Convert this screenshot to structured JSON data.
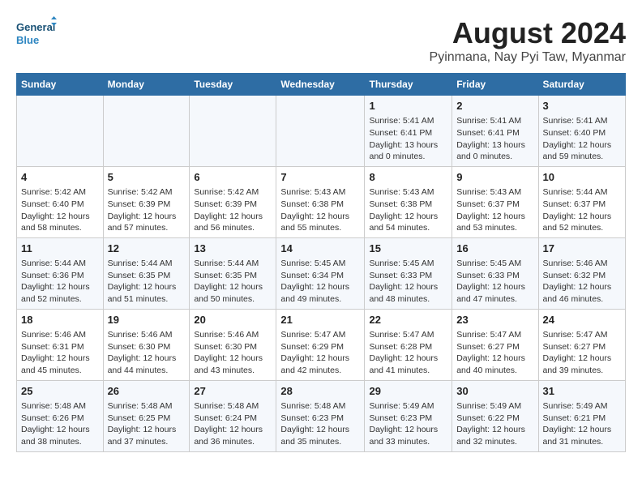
{
  "header": {
    "logo_line1": "General",
    "logo_line2": "Blue",
    "month_year": "August 2024",
    "location": "Pyinmana, Nay Pyi Taw, Myanmar"
  },
  "days_of_week": [
    "Sunday",
    "Monday",
    "Tuesday",
    "Wednesday",
    "Thursday",
    "Friday",
    "Saturday"
  ],
  "weeks": [
    [
      {
        "day": "",
        "content": ""
      },
      {
        "day": "",
        "content": ""
      },
      {
        "day": "",
        "content": ""
      },
      {
        "day": "",
        "content": ""
      },
      {
        "day": "1",
        "content": "Sunrise: 5:41 AM\nSunset: 6:41 PM\nDaylight: 13 hours and 0 minutes."
      },
      {
        "day": "2",
        "content": "Sunrise: 5:41 AM\nSunset: 6:41 PM\nDaylight: 13 hours and 0 minutes."
      },
      {
        "day": "3",
        "content": "Sunrise: 5:41 AM\nSunset: 6:40 PM\nDaylight: 12 hours and 59 minutes."
      }
    ],
    [
      {
        "day": "4",
        "content": "Sunrise: 5:42 AM\nSunset: 6:40 PM\nDaylight: 12 hours and 58 minutes."
      },
      {
        "day": "5",
        "content": "Sunrise: 5:42 AM\nSunset: 6:39 PM\nDaylight: 12 hours and 57 minutes."
      },
      {
        "day": "6",
        "content": "Sunrise: 5:42 AM\nSunset: 6:39 PM\nDaylight: 12 hours and 56 minutes."
      },
      {
        "day": "7",
        "content": "Sunrise: 5:43 AM\nSunset: 6:38 PM\nDaylight: 12 hours and 55 minutes."
      },
      {
        "day": "8",
        "content": "Sunrise: 5:43 AM\nSunset: 6:38 PM\nDaylight: 12 hours and 54 minutes."
      },
      {
        "day": "9",
        "content": "Sunrise: 5:43 AM\nSunset: 6:37 PM\nDaylight: 12 hours and 53 minutes."
      },
      {
        "day": "10",
        "content": "Sunrise: 5:44 AM\nSunset: 6:37 PM\nDaylight: 12 hours and 52 minutes."
      }
    ],
    [
      {
        "day": "11",
        "content": "Sunrise: 5:44 AM\nSunset: 6:36 PM\nDaylight: 12 hours and 52 minutes."
      },
      {
        "day": "12",
        "content": "Sunrise: 5:44 AM\nSunset: 6:35 PM\nDaylight: 12 hours and 51 minutes."
      },
      {
        "day": "13",
        "content": "Sunrise: 5:44 AM\nSunset: 6:35 PM\nDaylight: 12 hours and 50 minutes."
      },
      {
        "day": "14",
        "content": "Sunrise: 5:45 AM\nSunset: 6:34 PM\nDaylight: 12 hours and 49 minutes."
      },
      {
        "day": "15",
        "content": "Sunrise: 5:45 AM\nSunset: 6:33 PM\nDaylight: 12 hours and 48 minutes."
      },
      {
        "day": "16",
        "content": "Sunrise: 5:45 AM\nSunset: 6:33 PM\nDaylight: 12 hours and 47 minutes."
      },
      {
        "day": "17",
        "content": "Sunrise: 5:46 AM\nSunset: 6:32 PM\nDaylight: 12 hours and 46 minutes."
      }
    ],
    [
      {
        "day": "18",
        "content": "Sunrise: 5:46 AM\nSunset: 6:31 PM\nDaylight: 12 hours and 45 minutes."
      },
      {
        "day": "19",
        "content": "Sunrise: 5:46 AM\nSunset: 6:30 PM\nDaylight: 12 hours and 44 minutes."
      },
      {
        "day": "20",
        "content": "Sunrise: 5:46 AM\nSunset: 6:30 PM\nDaylight: 12 hours and 43 minutes."
      },
      {
        "day": "21",
        "content": "Sunrise: 5:47 AM\nSunset: 6:29 PM\nDaylight: 12 hours and 42 minutes."
      },
      {
        "day": "22",
        "content": "Sunrise: 5:47 AM\nSunset: 6:28 PM\nDaylight: 12 hours and 41 minutes."
      },
      {
        "day": "23",
        "content": "Sunrise: 5:47 AM\nSunset: 6:27 PM\nDaylight: 12 hours and 40 minutes."
      },
      {
        "day": "24",
        "content": "Sunrise: 5:47 AM\nSunset: 6:27 PM\nDaylight: 12 hours and 39 minutes."
      }
    ],
    [
      {
        "day": "25",
        "content": "Sunrise: 5:48 AM\nSunset: 6:26 PM\nDaylight: 12 hours and 38 minutes."
      },
      {
        "day": "26",
        "content": "Sunrise: 5:48 AM\nSunset: 6:25 PM\nDaylight: 12 hours and 37 minutes."
      },
      {
        "day": "27",
        "content": "Sunrise: 5:48 AM\nSunset: 6:24 PM\nDaylight: 12 hours and 36 minutes."
      },
      {
        "day": "28",
        "content": "Sunrise: 5:48 AM\nSunset: 6:23 PM\nDaylight: 12 hours and 35 minutes."
      },
      {
        "day": "29",
        "content": "Sunrise: 5:49 AM\nSunset: 6:23 PM\nDaylight: 12 hours and 33 minutes."
      },
      {
        "day": "30",
        "content": "Sunrise: 5:49 AM\nSunset: 6:22 PM\nDaylight: 12 hours and 32 minutes."
      },
      {
        "day": "31",
        "content": "Sunrise: 5:49 AM\nSunset: 6:21 PM\nDaylight: 12 hours and 31 minutes."
      }
    ]
  ]
}
